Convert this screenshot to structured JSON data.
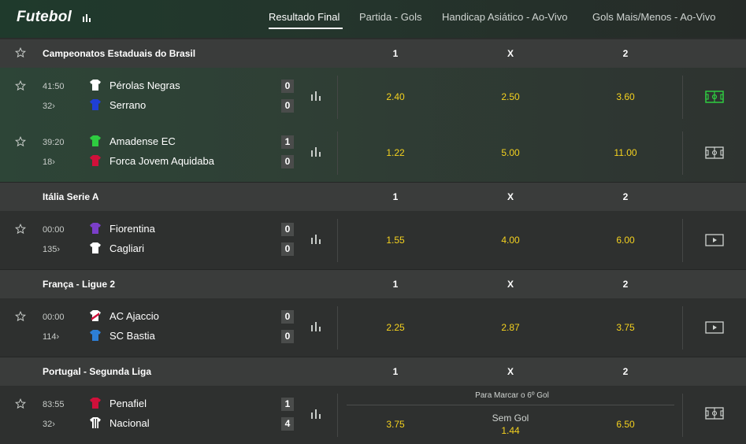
{
  "header": {
    "brand": "Futebol",
    "tabs": [
      {
        "label": "Resultado Final",
        "active": true
      },
      {
        "label": "Partida - Gols",
        "active": false
      },
      {
        "label": "Handicap Asiático - Ao-Vivo",
        "active": false
      },
      {
        "label": "Gols Mais/Menos - Ao-Vivo",
        "active": false
      }
    ]
  },
  "columns": {
    "home": "1",
    "draw": "X",
    "away": "2"
  },
  "sections": [
    {
      "title": "Campeonatos Estaduais do Brasil",
      "matches": [
        {
          "time": "41:50",
          "more": "32",
          "home": "Pérolas Negras",
          "away": "Serrano",
          "home_score": "0",
          "away_score": "0",
          "odd1": "2.40",
          "oddx": "2.50",
          "odd2": "3.60",
          "media": "pitch-icon",
          "home_shirt": "#ffffff",
          "away_shirt": "#1f3fd6"
        },
        {
          "time": "39:20",
          "more": "18",
          "home": "Amadense EC",
          "away": "Forca Jovem Aquidaba",
          "home_score": "1",
          "away_score": "0",
          "odd1": "1.22",
          "oddx": "5.00",
          "odd2": "11.00",
          "media": "pitch-icon",
          "home_shirt": "#2ecc40",
          "away_shirt": "#d0103a"
        }
      ]
    },
    {
      "title": "Itália Serie A",
      "matches": [
        {
          "time": "00:00",
          "more": "135",
          "home": "Fiorentina",
          "away": "Cagliari",
          "home_score": "0",
          "away_score": "0",
          "odd1": "1.55",
          "oddx": "4.00",
          "odd2": "6.00",
          "media": "play-icon",
          "home_shirt": "#7b3fc9",
          "away_shirt": "#ffffff"
        }
      ]
    },
    {
      "title": "França - Ligue 2",
      "matches": [
        {
          "time": "00:00",
          "more": "114",
          "home": "AC Ajaccio",
          "away": "SC Bastia",
          "home_score": "0",
          "away_score": "0",
          "odd1": "2.25",
          "oddx": "2.87",
          "odd2": "3.75",
          "media": "play-icon",
          "home_shirt": "#d0103a",
          "away_shirt": "#2d7fd6"
        }
      ]
    },
    {
      "title": "Portugal - Segunda Liga",
      "matches": [
        {
          "time": "83:55",
          "more": "32",
          "home": "Penafiel",
          "away": "Nacional",
          "home_score": "1",
          "away_score": "4",
          "odd1": "3.75",
          "oddx_label": "Sem Gol",
          "oddx": "1.44",
          "odd2": "6.50",
          "market_label": "Para Marcar o 6º Gol",
          "media": "pitch-icon",
          "home_shirt": "#d0103a",
          "away_shirt": "#ffffff"
        }
      ]
    }
  ],
  "colors": {
    "odds": "#f5d21f",
    "live_pitch": "#2ecc40",
    "background": "#2e302f"
  }
}
